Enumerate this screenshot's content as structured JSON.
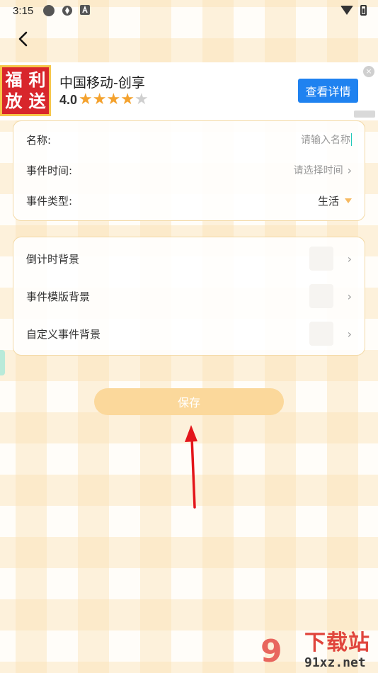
{
  "status_bar": {
    "time": "3:15"
  },
  "ad": {
    "logo_chars": [
      "福",
      "利",
      "放",
      "送"
    ],
    "title": "中国移动-创享",
    "rating": "4.0",
    "stars_filled": 4,
    "stars_total": 5,
    "button_label": "查看详情",
    "close_label": "×"
  },
  "form": {
    "name_label": "名称:",
    "name_placeholder": "请输入名称",
    "time_label": "事件时间:",
    "time_placeholder": "请选择时间",
    "type_label": "事件类型:",
    "type_value": "生活"
  },
  "backgrounds": {
    "countdown_label": "倒计时背景",
    "template_label": "事件模版背景",
    "custom_label": "自定义事件背景"
  },
  "save_label": "保存",
  "watermark": {
    "glyph": "9",
    "title": "下载站",
    "url": "91xz.net"
  },
  "colors": {
    "accent": "#f6b961",
    "save_button": "#fbd89b",
    "ad_button": "#1f82f0",
    "arrow": "#e3151a"
  }
}
